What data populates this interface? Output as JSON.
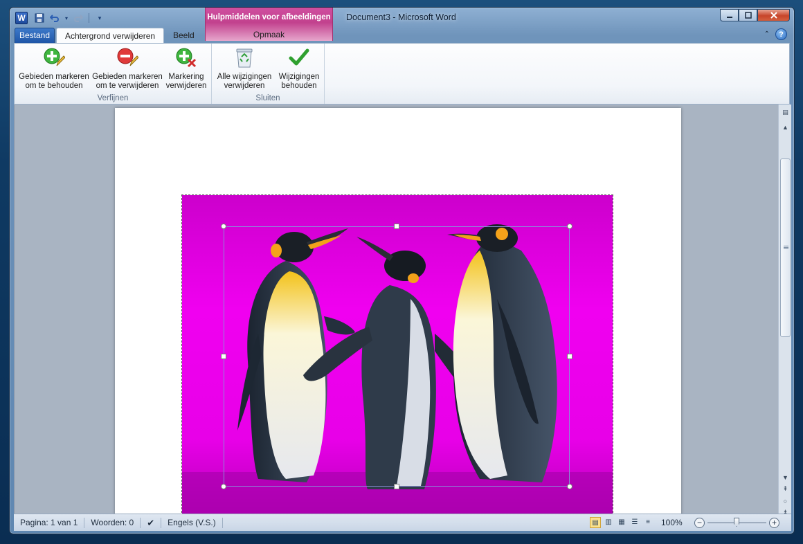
{
  "window": {
    "title": "Document3  -  Microsoft Word",
    "contextual_tab_group": "Hulpmiddelen voor afbeeldingen",
    "contextual_tab": "Opmaak"
  },
  "qat": {
    "app_icon_letter": "W"
  },
  "tabs": {
    "file": "Bestand",
    "background_removal": "Achtergrond verwijderen",
    "view": "Beeld"
  },
  "ribbon": {
    "groups": {
      "refine": {
        "label": "Verfijnen",
        "buttons": {
          "keep": "Gebieden markeren\nom te behouden",
          "remove": "Gebieden markeren\nom te verwijderen",
          "delete_mark": "Markering\nverwijderen"
        }
      },
      "close": {
        "label": "Sluiten",
        "buttons": {
          "discard": "Alle wijzigingen\nverwijderen",
          "keep_changes": "Wijzigingen\nbehouden"
        }
      }
    }
  },
  "status": {
    "page": "Pagina: 1 van 1",
    "words": "Woorden: 0",
    "language": "Engels (V.S.)",
    "zoom": "100%",
    "zoom_level_percent": 100
  },
  "colors": {
    "removal_overlay": "#e600e6",
    "contextual_tab": "#c2418e",
    "file_tab": "#2a62b5"
  }
}
